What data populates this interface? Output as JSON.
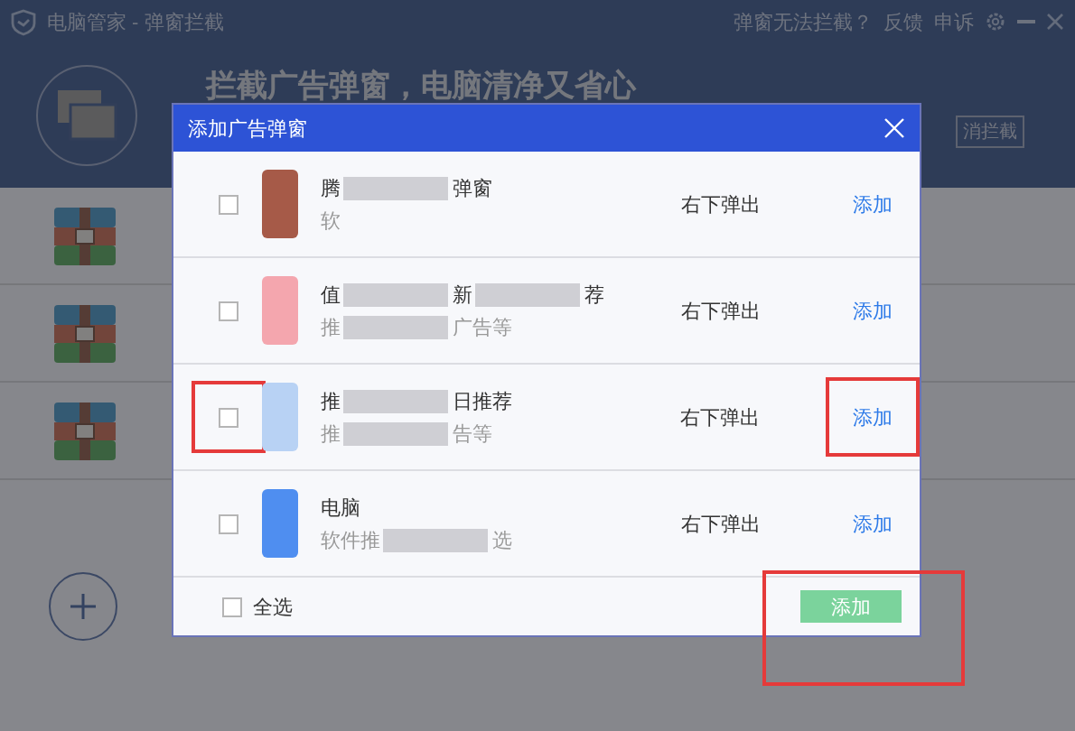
{
  "window": {
    "title": "电脑管家 - 弹窗拦截",
    "links": [
      "弹窗无法拦截？",
      "反馈",
      "申诉"
    ]
  },
  "header": {
    "headline": "拦截广告弹窗，电脑清净又省心",
    "button": "消拦截"
  },
  "dialog": {
    "title": "添加广告弹窗",
    "rows": [
      {
        "color": "#a65a48",
        "title": [
          "腾",
          "弹窗"
        ],
        "desc": [
          "软"
        ],
        "position": "右下弹出",
        "action": "添加",
        "checked": false,
        "checkbox_highlighted": false,
        "action_highlighted": false
      },
      {
        "color": "#f4a6ae",
        "title": [
          "值",
          "新",
          "荐"
        ],
        "desc": [
          "推",
          "广告等"
        ],
        "position": "右下弹出",
        "action": "添加",
        "checked": false,
        "checkbox_highlighted": false,
        "action_highlighted": false
      },
      {
        "color": "#b8d2f4",
        "title": [
          "推",
          "日推荐"
        ],
        "desc": [
          "推",
          "告等"
        ],
        "position": "右下弹出",
        "action": "添加",
        "checked": false,
        "checkbox_highlighted": true,
        "action_highlighted": true
      },
      {
        "color": "#4f8ef0",
        "title": [
          "电脑"
        ],
        "desc": [
          "软件推",
          "选"
        ],
        "position": "右下弹出",
        "action": "添加",
        "checked": false,
        "checkbox_highlighted": false,
        "action_highlighted": false
      }
    ],
    "footer": {
      "select_all": "全选",
      "select_all_checked": false,
      "button": "添加",
      "button_disabled": true,
      "button_highlighted": true
    }
  }
}
